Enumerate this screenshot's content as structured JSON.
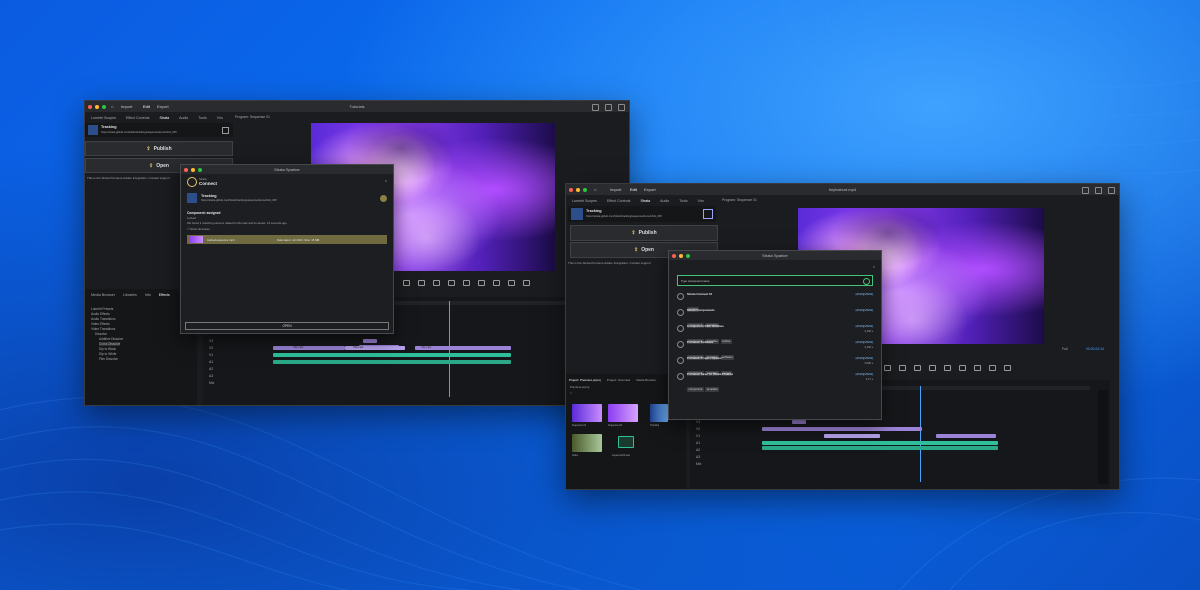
{
  "colors": {
    "accent_blue": "#0a6ff0",
    "clip_purple": "#9b84d8",
    "clip_green": "#2fbf9a",
    "highlight_gold": "#6f6a3f",
    "check_green": "#47c27a"
  },
  "left_window": {
    "title": "Tutorials",
    "nav": {
      "home": "Home",
      "import": "Import",
      "edit": "Edit",
      "export": "Export"
    },
    "tabs": [
      "Lumetri Scopes",
      "Effect Controls",
      "Strata",
      "Audio",
      "Tools",
      "Vim"
    ],
    "program_tab": "Program: Sequence 01",
    "tracking": {
      "title": "Tracking",
      "path": "https://strata.github.com/folder/tracking/sequence/items/cdd1_005"
    },
    "publish_label": "Publish",
    "open_label": "Open",
    "status_text": "This is the Strata Premiere Adobe Integration. Contact support",
    "effects_tabs": [
      "Media Browser",
      "Libraries",
      "Info",
      "Effects"
    ],
    "effects_tree": [
      "Lumetri Presets",
      "Audio Effects",
      "Audio Transitions",
      "Video Effects",
      "Video Transitions",
      "Dissolve",
      "Additive Dissolve",
      "Cross Dissolve",
      "Dip to Black",
      "Dip to White",
      "Film Dissolve"
    ],
    "track_labels": [
      "V3",
      "V2",
      "V1",
      "A1",
      "A2",
      "A3",
      "Mix"
    ],
    "clips": [
      "Clip.mp4",
      "Clip.mp4",
      "Clip.mp4"
    ]
  },
  "strata_connect_dialog": {
    "window_title": "Strata Sparker",
    "brand_top": "Strata",
    "brand_main": "Connect",
    "item_title": "Tracking",
    "item_path": "https://strata.github.com/folder/tracking/sequence/items/cdd1_005",
    "component_label": "Component: assigned",
    "component_value": "Locked",
    "message": "We found 1 matching element related to this task and its assets. 16 seconds ago",
    "show_all_label": "Show all assets",
    "selected_file": "trackedsequence.mp4",
    "selected_meta": "Date taken: Jul 2024, Size: 15 MB",
    "open_button": "OPEN"
  },
  "right_window": {
    "title": "tinyhaircut.mp4",
    "nav": {
      "home": "Home",
      "import": "Import",
      "edit": "Edit",
      "export": "Export"
    },
    "tabs": [
      "Lumetri Scopes",
      "Effect Controls",
      "Strata",
      "Audio",
      "Tools",
      "Vim"
    ],
    "program_tab": "Program: Sequence 01",
    "tracking": {
      "title": "Tracking",
      "path": "https://strata.github.com/folder/tracking/sequence/items/cdd1_005"
    },
    "publish_label": "Publish",
    "open_label": "Open",
    "status_text": "This is the Strata Premiere Adobe Integration. Contact support",
    "timecode": "00:00:24:14",
    "zoom": "Full",
    "project_tabs": [
      "Project: Premiere.prproj",
      "Project: Overview",
      "Media Browser"
    ],
    "project_name": "Premiere.prproj",
    "bin_items": [
      "Sequence 01",
      "Sequence 02",
      "Tracking",
      "Video",
      "sequence02.wav"
    ],
    "track_labels": [
      "V3",
      "V2",
      "V1",
      "A1",
      "A2",
      "A3",
      "Mix"
    ]
  },
  "strata_search_dialog": {
    "window_title": "Strata Sparker",
    "search_value": "Type component name",
    "results": [
      {
        "title": "Strata Connect UI",
        "tags": [
          "website"
        ],
        "link": "[ADD][VIEW]"
      },
      {
        "title": "Strata Components",
        "tags": [
          "component",
          "template"
        ],
        "link": "[ADD][VIEW]"
      },
      {
        "title": "Component Path Outlines",
        "tags": [
          "component",
          "template",
          "outline"
        ],
        "link": "[ADD][VIEW]",
        "meta": "2,100 s"
      },
      {
        "title": "Premiere Software",
        "tags": [
          "component",
          "template",
          "software"
        ],
        "link": "[ADD][VIEW]",
        "meta": "2,100 s"
      },
      {
        "title": "Premiere Project Opener",
        "tags": [
          "component",
          "template",
          "opener"
        ],
        "link": "[ADD][VIEW]",
        "meta": "2,500 s"
      },
      {
        "title": "Premiere Save To Strata Finalize",
        "tags": [
          "component",
          "template"
        ],
        "link": "[ADD][VIEW]",
        "meta": "2,17 s"
      }
    ]
  }
}
